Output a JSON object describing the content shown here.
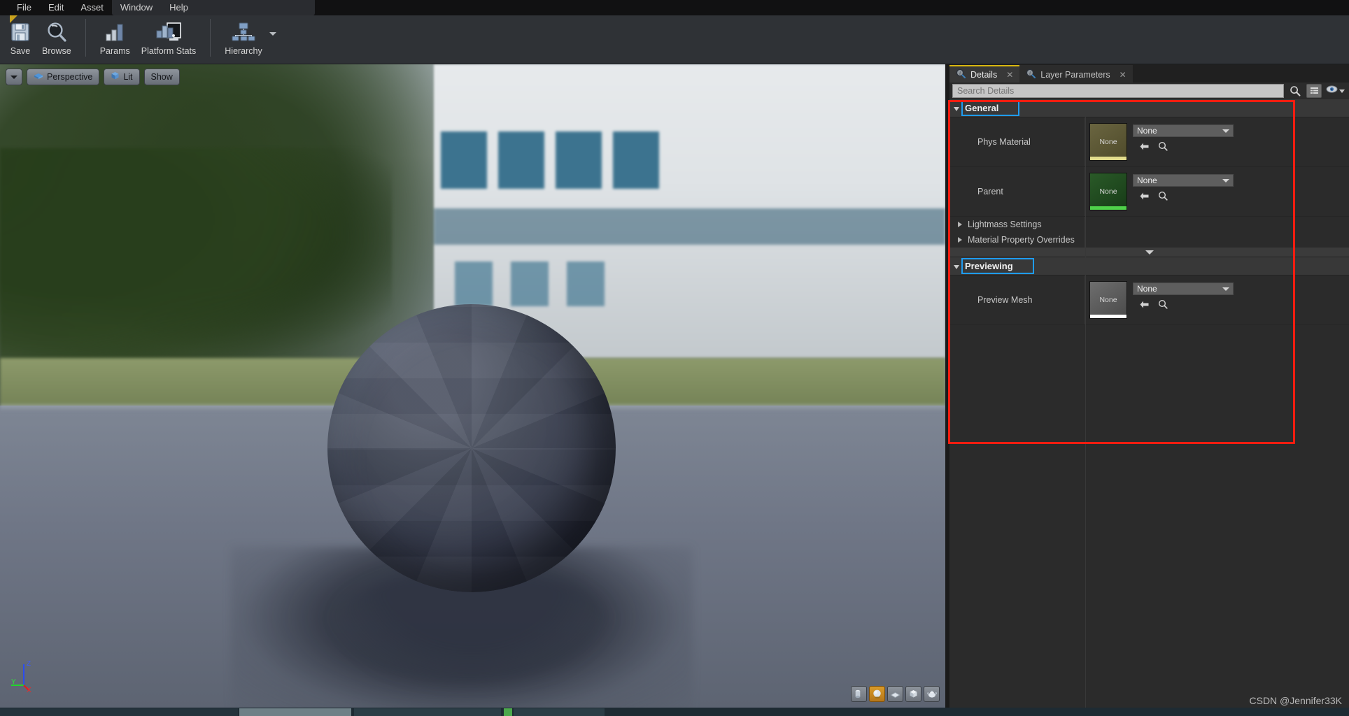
{
  "menubar": {
    "items": [
      "File",
      "Edit",
      "Asset",
      "Window",
      "Help"
    ]
  },
  "toolbar": {
    "groups": [
      {
        "buttons": [
          {
            "label": "Save",
            "icon": "save-disk-icon"
          },
          {
            "label": "Browse",
            "icon": "magnifier-browse-icon"
          }
        ]
      },
      {
        "buttons": [
          {
            "label": "Params",
            "icon": "bar-chart-params-icon"
          },
          {
            "label": "Platform Stats",
            "icon": "platform-stats-icon"
          }
        ]
      },
      {
        "buttons": [
          {
            "label": "Hierarchy",
            "icon": "hierarchy-tree-icon"
          }
        ]
      }
    ]
  },
  "viewport": {
    "buttons": [
      {
        "label": "",
        "icon": "chevron-down-icon",
        "name": "viewport-options-button"
      },
      {
        "label": "Perspective",
        "icon": "perspective-camera-icon",
        "name": "view-mode-perspective-button"
      },
      {
        "label": "Lit",
        "icon": "lit-cube-icon",
        "name": "lighting-mode-lit-button"
      },
      {
        "label": "Show",
        "icon": "",
        "name": "show-flags-button"
      }
    ],
    "primitives": [
      {
        "name": "primitive-cylinder",
        "icon": "cylinder-icon",
        "selected": false
      },
      {
        "name": "primitive-sphere",
        "icon": "sphere-icon",
        "selected": true
      },
      {
        "name": "primitive-plane",
        "icon": "plane-icon",
        "selected": false
      },
      {
        "name": "primitive-cube",
        "icon": "cube-icon",
        "selected": false
      },
      {
        "name": "primitive-teapot",
        "icon": "teapot-icon",
        "selected": false
      }
    ],
    "gizmo_axes": [
      "X",
      "Y",
      "Z"
    ]
  },
  "details_panel": {
    "tabs": [
      {
        "label": "Details",
        "icon": "details-magnifier-icon",
        "active": true,
        "closable": true
      },
      {
        "label": "Layer Parameters",
        "icon": "layer-params-magnifier-icon",
        "active": false,
        "closable": true
      }
    ],
    "search": {
      "placeholder": "Search Details",
      "value": ""
    },
    "toolbar_icons": [
      {
        "name": "search-icon",
        "glyph": "magnifier"
      },
      {
        "name": "grid-view-icon",
        "glyph": "grid"
      },
      {
        "name": "visibility-eye-icon",
        "glyph": "eye"
      },
      {
        "name": "chevron-down-icon",
        "glyph": "caret"
      }
    ],
    "categories": [
      {
        "name": "general",
        "label": "General",
        "expanded": true,
        "highlighted": true,
        "rows": [
          {
            "type": "asset",
            "label": "Phys Material",
            "thumb_text": "None",
            "thumb_color": "#5d5a33",
            "thumb_bar_color": "#e2dc8c",
            "combo_value": "None",
            "actions": [
              "use-selected-arrow-icon",
              "browse-magnifier-icon"
            ]
          },
          {
            "type": "asset",
            "label": "Parent",
            "thumb_text": "None",
            "thumb_color": "#20491f",
            "thumb_bar_color": "#4fd24a",
            "combo_value": "None",
            "actions": [
              "use-selected-arrow-icon",
              "browse-magnifier-icon"
            ]
          },
          {
            "type": "subcategory",
            "label": "Lightmass Settings",
            "expanded": false
          },
          {
            "type": "subcategory",
            "label": "Material Property Overrides",
            "expanded": false
          }
        ]
      },
      {
        "name": "previewing",
        "label": "Previewing",
        "expanded": true,
        "highlighted": true,
        "rows": [
          {
            "type": "asset",
            "label": "Preview Mesh",
            "thumb_text": "None",
            "thumb_color": "#5a5a5a",
            "thumb_bar_color": "#ffffff",
            "combo_value": "None",
            "actions": [
              "use-selected-arrow-icon",
              "browse-magnifier-icon"
            ]
          }
        ]
      }
    ]
  },
  "annotations": {
    "highlight_color": "#1f9cf0",
    "callout_color": "#fb1d10"
  },
  "watermark": "CSDN @Jennifer33K"
}
